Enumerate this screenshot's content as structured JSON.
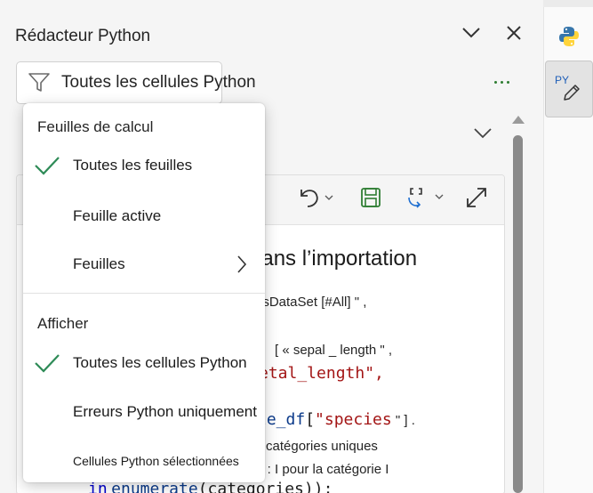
{
  "header": {
    "title": "Rédacteur Python"
  },
  "filter": {
    "label": "Toutes les cellules Python"
  },
  "code": {
    "heading_fragment": "dans l’importation",
    "line1": "risDataSet [#All] \" ,",
    "line2_prefix": "[ « sepal _ length \" ,",
    "line3": "etal_length\",",
    "line4_fn": "le_df",
    "line4_open": "[",
    "line4_str": "\"species",
    "line4_close": " \" ] .",
    "line5": "catégories uniques",
    "line6": "y : I pour la catégorie I",
    "line7_kw": "in",
    "line7_fn": "enumerate",
    "line7_arg": "(categories)):"
  },
  "menu": {
    "section_sheets": "Feuilles de calcul",
    "items_sheets": [
      {
        "label": "Toutes les feuilles",
        "checked": true
      },
      {
        "label": "Feuille active",
        "checked": false
      },
      {
        "label": "Feuilles",
        "checked": false,
        "submenu": true
      }
    ],
    "section_show": "Afficher",
    "items_show": [
      {
        "label": "Toutes les cellules Python",
        "checked": true
      },
      {
        "label": "Erreurs Python uniquement",
        "checked": false
      },
      {
        "label": "Cellules Python sélectionnées",
        "checked": false
      }
    ]
  },
  "rail": {
    "editor_label": "PY"
  },
  "colors": {
    "accent_green": "#2e7d32",
    "checkmark": "#2e8b57",
    "python_blue": "#3776ab",
    "python_yellow": "#ffd43b"
  }
}
